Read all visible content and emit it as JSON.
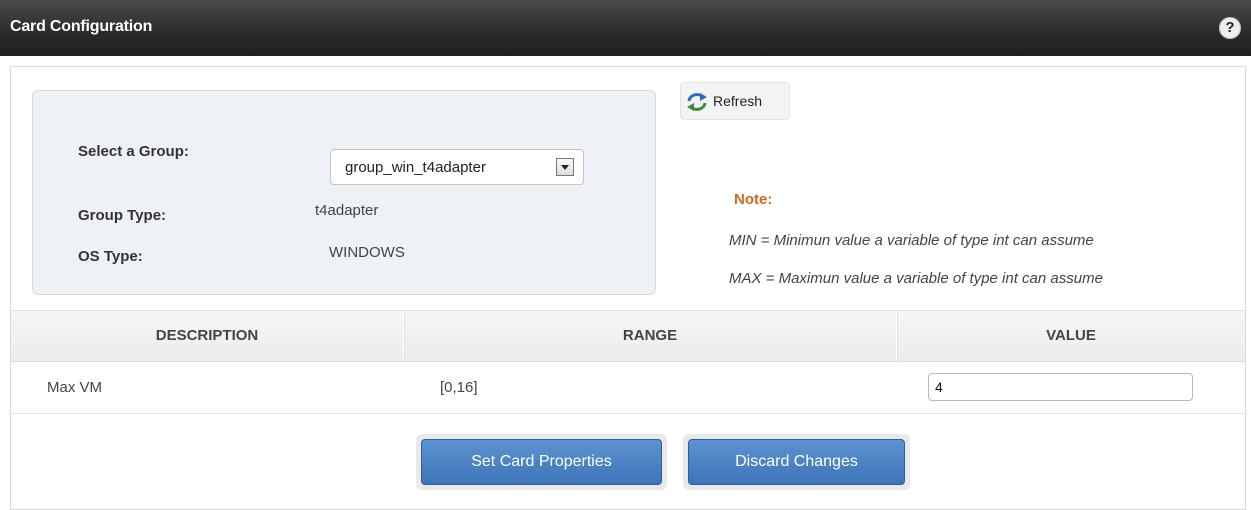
{
  "header": {
    "title": "Card Configuration",
    "help_label": "?"
  },
  "refresh": {
    "label": "Refresh"
  },
  "group": {
    "select_label": "Select a Group:",
    "selected_group": "group_win_t4adapter",
    "group_type_label": "Group Type:",
    "group_type_value": "t4adapter",
    "os_type_label": "OS Type:",
    "os_type_value": "WINDOWS"
  },
  "note": {
    "title": "Note:",
    "min_line": "MIN = Minimun value a variable of type int can assume",
    "max_line": "MAX = Maximun value a variable of type int can assume"
  },
  "table": {
    "columns": [
      "DESCRIPTION",
      "RANGE",
      "VALUE"
    ],
    "rows": [
      {
        "description": "Max VM",
        "range": "[0,16]",
        "value": "4"
      }
    ]
  },
  "actions": {
    "set_label": "Set Card Properties",
    "discard_label": "Discard Changes"
  },
  "colors": {
    "header": "#2a2a2a",
    "note": "#d2691e",
    "button": "#3d74b8"
  },
  "icons": {
    "help": "help-icon",
    "refresh": "refresh-icon",
    "dropdown": "chevron-down-icon"
  }
}
